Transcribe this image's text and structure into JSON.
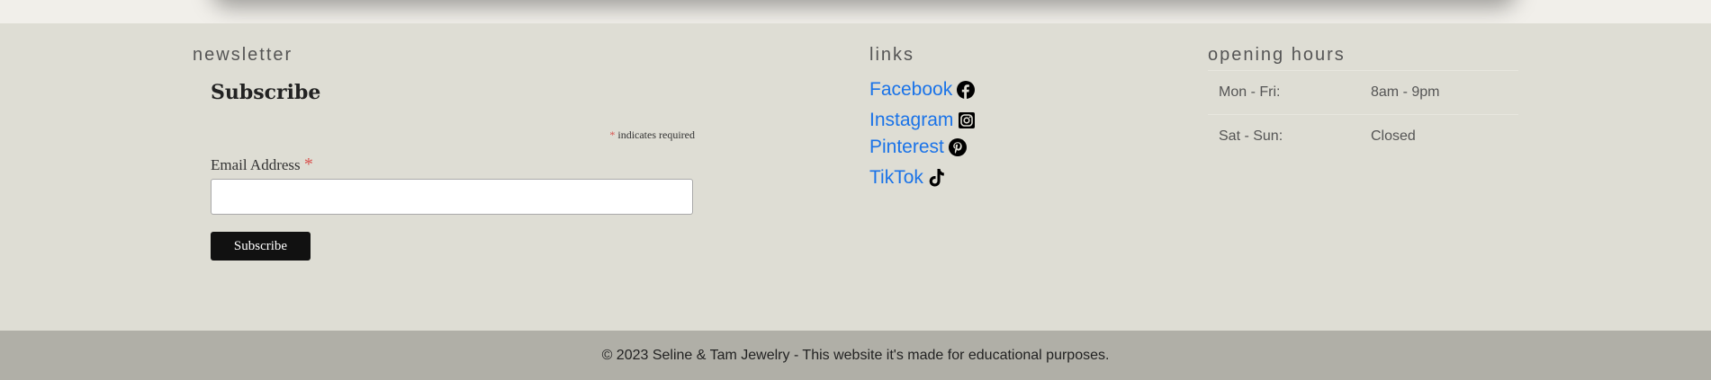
{
  "newsletter": {
    "title": "newsletter",
    "heading": "Subscribe",
    "required_asterisk": "*",
    "required_note": " indicates required",
    "email_label": "Email Address ",
    "email_asterisk": "*",
    "email_value": "",
    "email_placeholder": "",
    "subscribe_label": "Subscribe"
  },
  "links": {
    "title": "links",
    "items": [
      {
        "label": "Facebook",
        "icon": "facebook-icon"
      },
      {
        "label": "Instagram",
        "icon": "instagram-icon"
      },
      {
        "label": "Pinterest",
        "icon": "pinterest-icon"
      },
      {
        "label": "TikTok",
        "icon": "tiktok-icon"
      }
    ]
  },
  "hours": {
    "title": "opening hours",
    "rows": [
      {
        "day": "Mon - Fri:",
        "time": "8am - 9pm"
      },
      {
        "day": "Sat - Sun:",
        "time": "Closed"
      }
    ]
  },
  "footer": {
    "copyright": "© 2023 Seline & Tam Jewelry - This website it's made for educational purposes."
  },
  "colors": {
    "footer_bg": "#deddd4",
    "copyright_bg": "#b0afa7",
    "link": "#1a73e8",
    "button_bg": "#111111",
    "required": "#d9534f"
  }
}
